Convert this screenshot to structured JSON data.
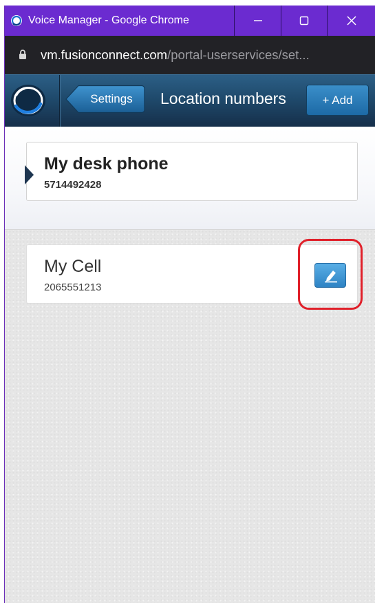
{
  "window": {
    "title": "Voice Manager - Google Chrome",
    "controls": {
      "minimize_icon": "minimize-icon",
      "maximize_icon": "maximize-icon",
      "close_icon": "close-icon"
    }
  },
  "address_bar": {
    "host": "vm.fusionconnect.com",
    "path": "/portal-userservices/set..."
  },
  "header": {
    "back_label": "Settings",
    "title": "Location numbers",
    "add_label": "+ Add"
  },
  "locations": {
    "selected": {
      "name": "My desk phone",
      "number": "5714492428"
    },
    "items": [
      {
        "name": "My Cell",
        "number": "2065551213",
        "action_icon": "edit-icon"
      }
    ]
  },
  "colors": {
    "titlebar": "#6b2bd0",
    "address_bar": "#222226",
    "header_top": "#2c5f86",
    "header_bottom": "#162f4a",
    "edit_button": "#3a91d3",
    "highlight": "#e0202a"
  }
}
